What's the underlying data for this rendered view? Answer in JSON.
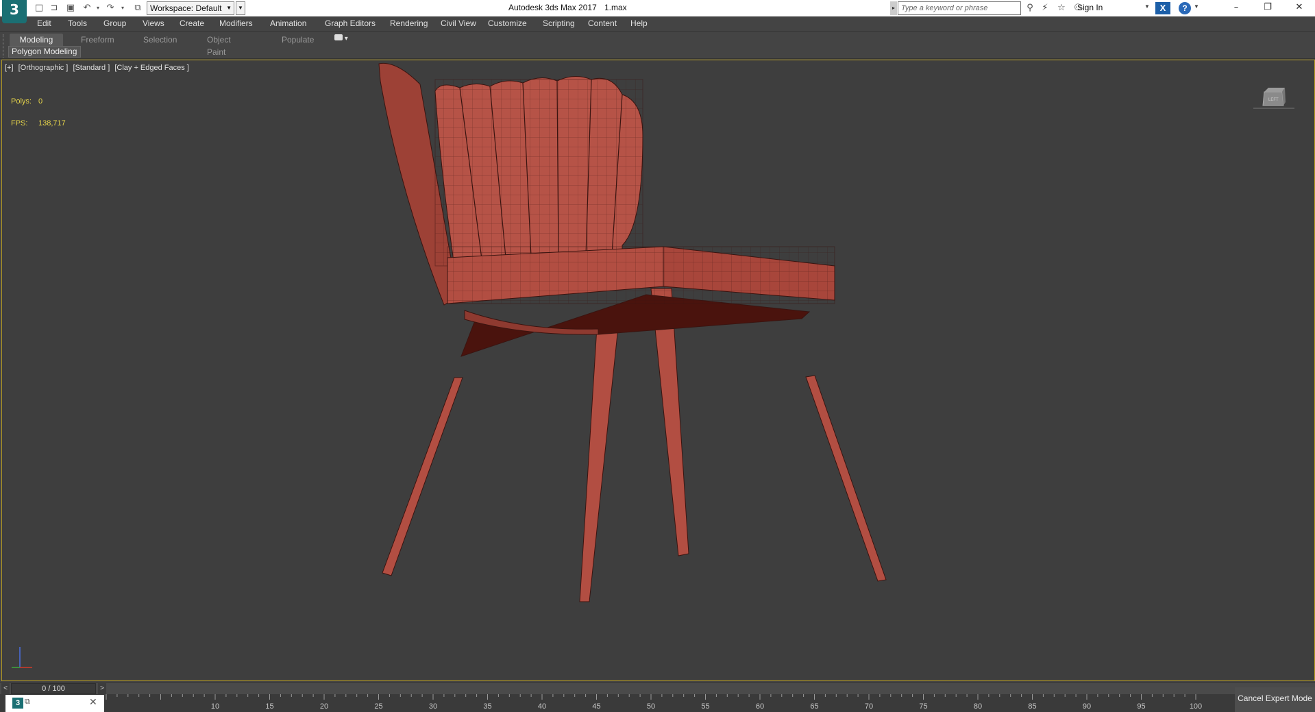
{
  "titlebar": {
    "logo": "3",
    "workspace_label": "Workspace: Default",
    "app_title": "Autodesk 3ds Max 2017",
    "file_name": "1.max",
    "search_placeholder": "Type a keyword or phrase",
    "sign_in": "Sign In"
  },
  "menus": [
    "Edit",
    "Tools",
    "Group",
    "Views",
    "Create",
    "Modifiers",
    "Animation",
    "Graph Editors",
    "Rendering",
    "Civil View",
    "Customize",
    "Scripting",
    "Content",
    "Help"
  ],
  "ribbon": {
    "tabs": [
      "Modeling",
      "Freeform",
      "Selection",
      "Object Paint",
      "Populate"
    ],
    "panel_label": "Polygon Modeling"
  },
  "viewport": {
    "label_parts": [
      "[+]",
      "[Orthographic ]",
      "[Standard ]",
      "[Clay + Edged Faces ]"
    ],
    "polys_label": "Polys:",
    "polys_value": "0",
    "fps_label": "FPS:",
    "fps_value": "138,717",
    "viewcube_face": "LEFT",
    "model_color": "#b04a3e",
    "border_color": "#b59b22"
  },
  "timeslider": {
    "frame_readout": "0 / 100",
    "prev": "<",
    "next": ">",
    "ticks": [
      "10",
      "15",
      "20",
      "25",
      "30",
      "35",
      "40",
      "45",
      "50",
      "55",
      "60",
      "65",
      "70",
      "75",
      "80",
      "85",
      "90",
      "95",
      "100"
    ]
  },
  "status": {
    "cancel_expert_mode": "Cancel Expert Mode"
  }
}
